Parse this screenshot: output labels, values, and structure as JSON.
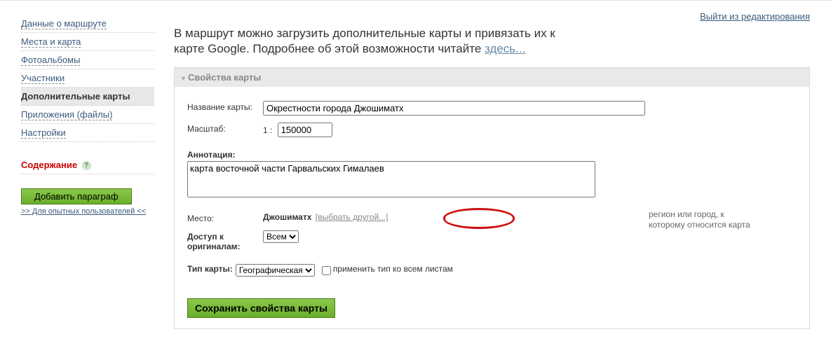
{
  "header": {
    "exit_link": "Выйти из редактирования"
  },
  "nav": {
    "items": [
      {
        "label": "Данные о маршруте"
      },
      {
        "label": "Места и карта"
      },
      {
        "label": "Фотоальбомы"
      },
      {
        "label": "Участники"
      },
      {
        "label": "Дополнительные карты"
      },
      {
        "label": "Приложения (файлы)"
      },
      {
        "label": "Настройки"
      }
    ],
    "contents_head": "Содержание",
    "add_paragraph": "Добавить параграф",
    "adv_link": ">> Для опытных пользователей <<"
  },
  "intro": {
    "text_part1": "В маршрут можно загрузить дополнительные карты и привязать их к карте Google. Подробнее об этой возможности читайте ",
    "link": "здесь..."
  },
  "panel": {
    "title": "Свойства карты",
    "name_label": "Название карты:",
    "name_value": "Окрестности города Джошиматх",
    "scale_label": "Масштаб:",
    "scale_prefix": "1 :",
    "scale_value": "150000",
    "annotation_label": "Аннотация:",
    "annotation_value": "карта восточной части Гарвальских Гималаев",
    "place_label": "Место:",
    "place_value": "Джошиматх",
    "place_other": "[выбрать другой...]",
    "place_hint": "регион или город, к которому относится карта",
    "access_label": "Доступ к оригиналам:",
    "access_value": "Всем",
    "type_label": "Тип карты:",
    "type_value": "Географическая",
    "apply_all": "применить тип ко всем листам",
    "save": "Сохранить свойства карты"
  }
}
